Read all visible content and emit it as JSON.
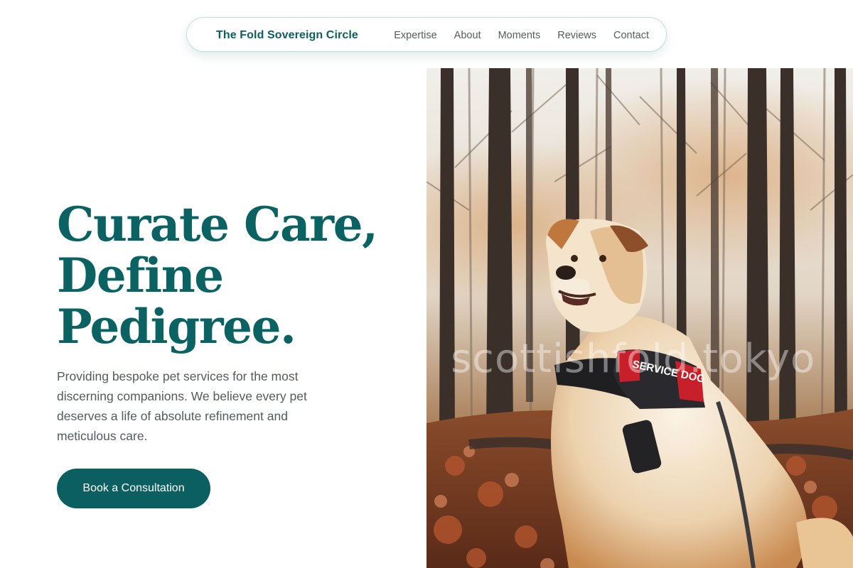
{
  "nav": {
    "brand": "The Fold Sovereign Circle",
    "links": [
      "Expertise",
      "About",
      "Moments",
      "Reviews",
      "Contact"
    ]
  },
  "hero": {
    "title_lines": [
      "Curate Care,",
      "Define",
      "Pedigree."
    ],
    "description": "Providing bespoke pet services for the most discerning companions. We believe every pet deserves a life of absolute refinement and meticulous care.",
    "cta_label": "Book a Consultation"
  },
  "photo": {
    "harness_text": "SERVICE DOG",
    "watermark": "scottishfold.tokyo"
  },
  "colors": {
    "brand_teal": "#0b6262",
    "button_teal": "#0b5f60",
    "body_text": "#545a5f",
    "nav_border": "#bfe0da"
  }
}
